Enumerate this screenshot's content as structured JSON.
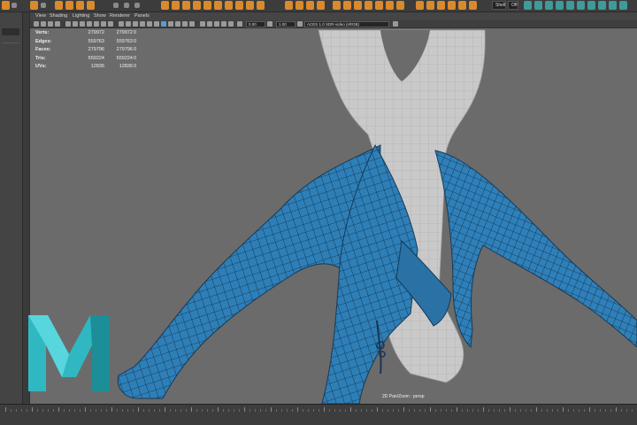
{
  "viewport_menu": {
    "items": [
      "View",
      "Shading",
      "Lighting",
      "Show",
      "Renderer",
      "Panels"
    ]
  },
  "viewport_toolbar": {
    "field_1": "0.00",
    "field_2": "1.00",
    "color_space": "ACES 1.0 SDR-video (sRGB)"
  },
  "hud": {
    "rows": [
      {
        "label": "Verts:",
        "v1": "279972",
        "v2": "279972",
        "v3": "0"
      },
      {
        "label": "Edges:",
        "v1": "559763",
        "v2": "559763",
        "v3": "0"
      },
      {
        "label": "Faces:",
        "v1": "279796",
        "v2": "279796",
        "v3": "0"
      },
      {
        "label": "Tris:",
        "v1": "559224",
        "v2": "559224",
        "v3": "0"
      },
      {
        "label": "UVs:",
        "v1": "12836",
        "v2": "12836",
        "v3": "0"
      }
    ]
  },
  "camera_label": "2D Pan/Zoom : persp",
  "status_right": {
    "field_a": "Shell",
    "field_b": "Off"
  },
  "colors": {
    "viewport_bg": "#6b6b6b",
    "mesh_blue": "#2e7fb8",
    "mesh_grey": "#c8c8c8",
    "logo_teal": "#2fb8c2"
  }
}
